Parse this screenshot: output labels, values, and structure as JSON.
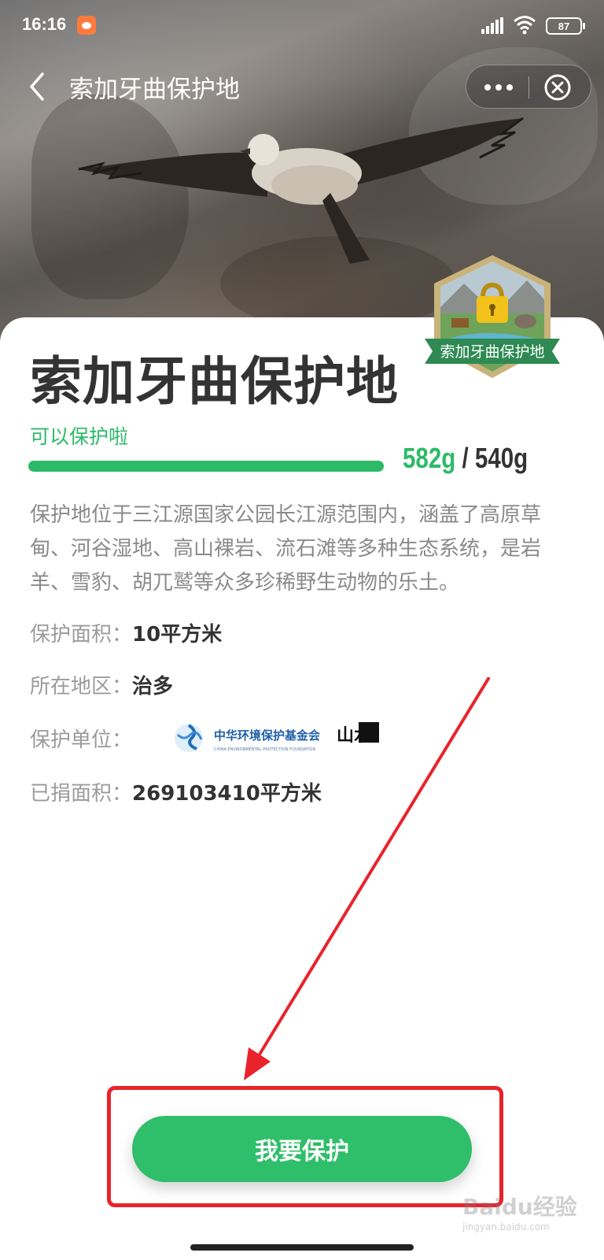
{
  "status_bar": {
    "time": "16:16",
    "battery": "87"
  },
  "nav": {
    "title": "索加牙曲保护地"
  },
  "card": {
    "title": "索加牙曲保护地",
    "badge_label": "索加牙曲保护地",
    "status_label": "可以保护啦",
    "progress": {
      "current": "582g",
      "separator": " / ",
      "target": "540g",
      "fraction": 1.0
    },
    "description": "保护地位于三江源国家公园长江源范围内，涵盖了高原草甸、河谷湿地、高山裸岩、流石滩等多种生态系统，是岩羊、雪豹、胡兀鹫等众多珍稀野生动物的乐土。",
    "info": {
      "area_label": "保护面积：",
      "area_value": "10平方米",
      "region_label": "所在地区：",
      "region_value": "治多",
      "org_label": "保护单位：",
      "org_logo_1_text": "中华环境保护基金会",
      "org_logo_1_subtext": "CHINA ENVIRONMENTAL PROTECTION FOUNDATION",
      "org_logo_2_text": "山水",
      "donated_label": "已捐面积：",
      "donated_value": "269103410平方米"
    },
    "cta_label": "我要保护"
  },
  "watermark": {
    "text": "Baidu经验",
    "url_text": "jingyan.baidu.com"
  },
  "colors": {
    "accent_green": "#2fbe69",
    "annotation_red": "#e8232c"
  },
  "icons": [
    "back-icon",
    "more-icon",
    "close-icon",
    "signal-icon",
    "wifi-icon",
    "battery-icon",
    "lock-icon"
  ]
}
